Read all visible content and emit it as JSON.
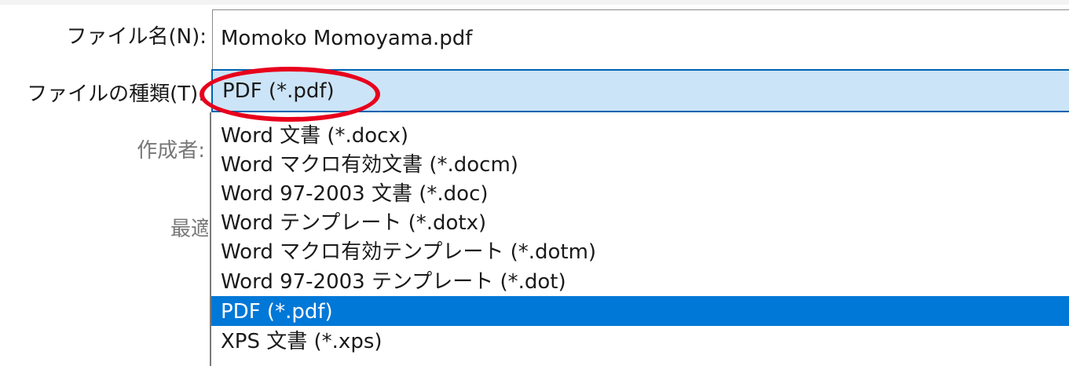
{
  "form": {
    "filename_label": "ファイル名(N):",
    "filename_value": "Momoko Momoyama.pdf",
    "filetype_label": "ファイルの種類(T):",
    "filetype_value": "PDF (*.pdf)",
    "author_label": "作成者:",
    "optimize_label": "最適"
  },
  "filetype_options": [
    {
      "label": "Word 文書 (*.docx)",
      "selected": false
    },
    {
      "label": "Word マクロ有効文書 (*.docm)",
      "selected": false
    },
    {
      "label": "Word 97-2003 文書 (*.doc)",
      "selected": false
    },
    {
      "label": "Word テンプレート (*.dotx)",
      "selected": false
    },
    {
      "label": "Word マクロ有効テンプレート (*.dotm)",
      "selected": false
    },
    {
      "label": "Word 97-2003 テンプレート (*.dot)",
      "selected": false
    },
    {
      "label": "PDF (*.pdf)",
      "selected": true
    },
    {
      "label": "XPS 文書 (*.xps)",
      "selected": false
    }
  ],
  "colors": {
    "selection_highlight": "#0078d7",
    "select_background": "#cce4f7",
    "annotation": "#e8001c"
  }
}
